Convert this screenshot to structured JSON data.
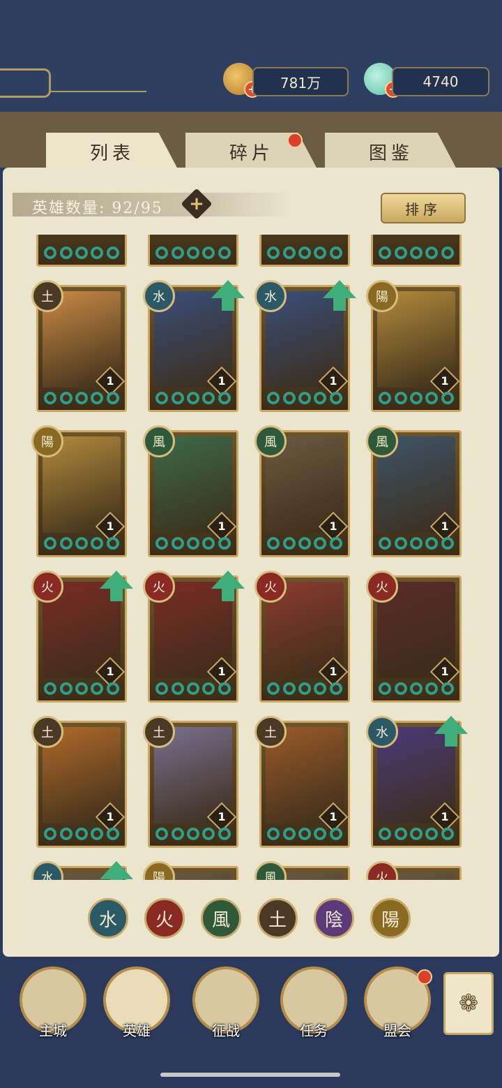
{
  "currency": {
    "coins": "781万",
    "jade": "4740"
  },
  "tabs": [
    {
      "label": "列表",
      "active": true
    },
    {
      "label": "碎片",
      "active": false,
      "badge": true
    },
    {
      "label": "图鉴",
      "active": false
    }
  ],
  "hero_count": {
    "label": "英雄数量:",
    "value": "92/95"
  },
  "sort_label": "排序",
  "element_glyphs": {
    "water": "水",
    "fire": "火",
    "wind": "風",
    "earth": "土",
    "yin": "陰",
    "yang": "陽"
  },
  "colors": {
    "water": "#2b5a66",
    "fire": "#8a2a22",
    "wind": "#2f5a3a",
    "earth": "#4a3a25",
    "yin": "#5c3a7a",
    "yang": "#8a6a22",
    "upgrade_arrow": "#3fae7a",
    "badge_red": "#d9412a"
  },
  "heroes": [
    {
      "element": "earth",
      "level": "1",
      "upgrade": false,
      "stars": 5,
      "tone": "#c98a45"
    },
    {
      "element": "water",
      "level": "1",
      "upgrade": true,
      "stars": 5,
      "tone": "#3a4e7a"
    },
    {
      "element": "water",
      "level": "1",
      "upgrade": true,
      "stars": 5,
      "tone": "#3a4e7a"
    },
    {
      "element": "yang",
      "level": "1",
      "upgrade": false,
      "stars": 5,
      "tone": "#b38a3c"
    },
    {
      "element": "yang",
      "level": "1",
      "upgrade": false,
      "stars": 5,
      "tone": "#b38a3c"
    },
    {
      "element": "wind",
      "level": "1",
      "upgrade": false,
      "stars": 5,
      "tone": "#3c6a4a"
    },
    {
      "element": "wind",
      "level": "1",
      "upgrade": false,
      "stars": 5,
      "tone": "#6a5a42"
    },
    {
      "element": "wind",
      "level": "1",
      "upgrade": false,
      "stars": 5,
      "tone": "#3e5468"
    },
    {
      "element": "fire",
      "level": "1",
      "upgrade": true,
      "stars": 5,
      "tone": "#7a2b26"
    },
    {
      "element": "fire",
      "level": "1",
      "upgrade": true,
      "stars": 5,
      "tone": "#7a2b26"
    },
    {
      "element": "fire",
      "level": "1",
      "upgrade": false,
      "stars": 5,
      "tone": "#8a3b2e"
    },
    {
      "element": "fire",
      "level": "1",
      "upgrade": false,
      "stars": 5,
      "tone": "#5a2a2a"
    },
    {
      "element": "earth",
      "level": "1",
      "upgrade": false,
      "stars": 5,
      "tone": "#b06a2a"
    },
    {
      "element": "earth",
      "level": "1",
      "upgrade": false,
      "stars": 5,
      "tone": "#7a7090"
    },
    {
      "element": "earth",
      "level": "1",
      "upgrade": false,
      "stars": 5,
      "tone": "#9a5a2a"
    },
    {
      "element": "water",
      "level": "1",
      "upgrade": true,
      "stars": 5,
      "tone": "#4a3a7a"
    }
  ],
  "partial_row_bottom": [
    {
      "element": "water",
      "upgrade": true
    },
    {
      "element": "yang",
      "upgrade": false
    },
    {
      "element": "wind",
      "upgrade": false
    },
    {
      "element": "fire",
      "upgrade": false
    }
  ],
  "filters": [
    "water",
    "fire",
    "wind",
    "earth",
    "yin",
    "yang"
  ],
  "nav": [
    {
      "label": "主城",
      "badge": false,
      "active": false
    },
    {
      "label": "英雄",
      "badge": false,
      "active": true
    },
    {
      "label": "征战",
      "badge": false,
      "active": false
    },
    {
      "label": "任务",
      "badge": false,
      "active": false
    },
    {
      "label": "盟会",
      "badge": true,
      "active": false
    }
  ]
}
